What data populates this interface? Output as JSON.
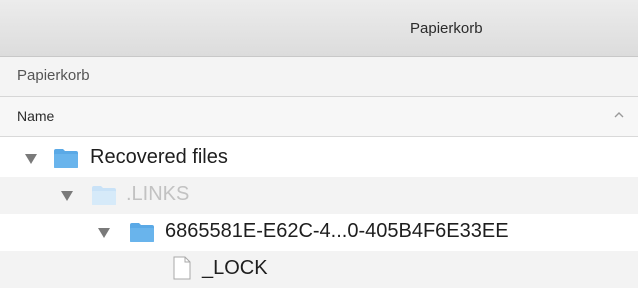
{
  "window": {
    "title": "Papierkorb"
  },
  "pathbar": {
    "label": "Papierkorb"
  },
  "columns": {
    "name": "Name"
  },
  "tree": {
    "recovered": "Recovered files",
    "links": ".LINKS",
    "guid_folder": "6865581E-E62C-4...0-405B4F6E33EE",
    "lock_file": "_LOCK"
  },
  "colors": {
    "folder_blue": "#5aa9e6",
    "folder_faded": "#c9e2f7"
  }
}
